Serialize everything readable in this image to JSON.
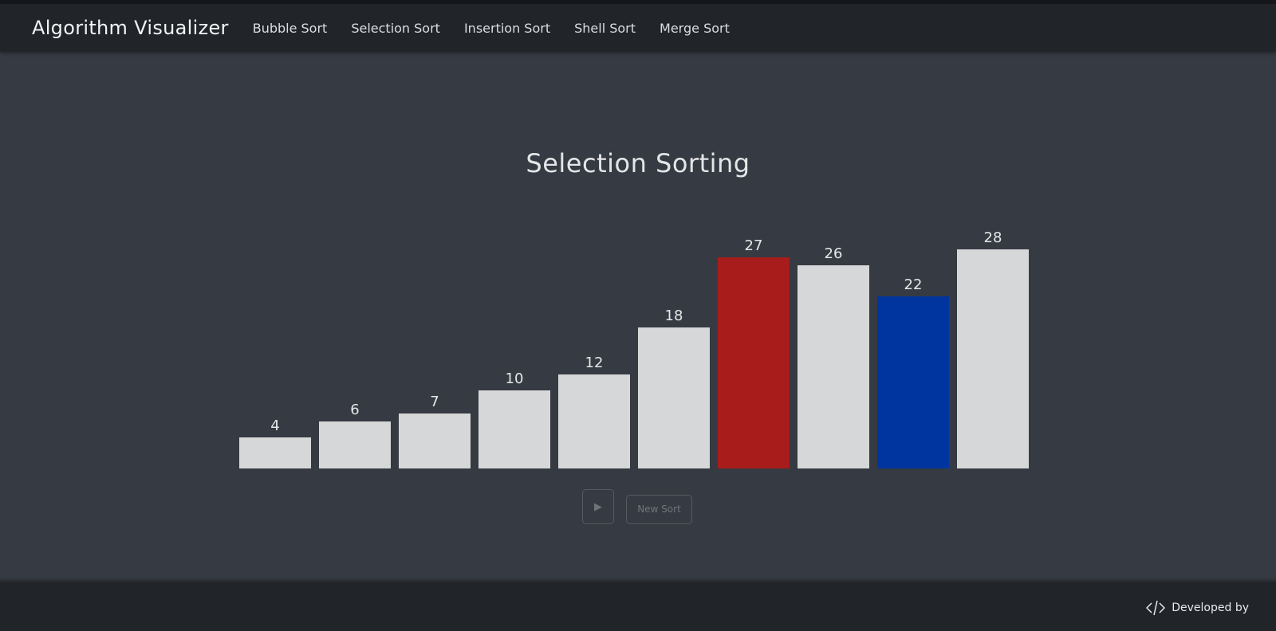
{
  "navbar": {
    "brand": "Algorithm Visualizer",
    "links": [
      "Bubble Sort",
      "Selection Sort",
      "Insertion Sort",
      "Shell Sort",
      "Merge Sort"
    ]
  },
  "main": {
    "title": "Selection Sorting"
  },
  "chart_data": {
    "type": "bar",
    "values": [
      4,
      6,
      7,
      10,
      12,
      18,
      27,
      26,
      22,
      28
    ],
    "highlight": {
      "6": "#a81c1c",
      "8": "#0035a0"
    },
    "default_color": "#d6d7d8",
    "ylim": [
      0,
      28
    ]
  },
  "controls": {
    "play_icon": "play-icon",
    "new_sort_label": "New Sort"
  },
  "footer": {
    "icon": "code-icon",
    "developed_by": "Developed by"
  }
}
